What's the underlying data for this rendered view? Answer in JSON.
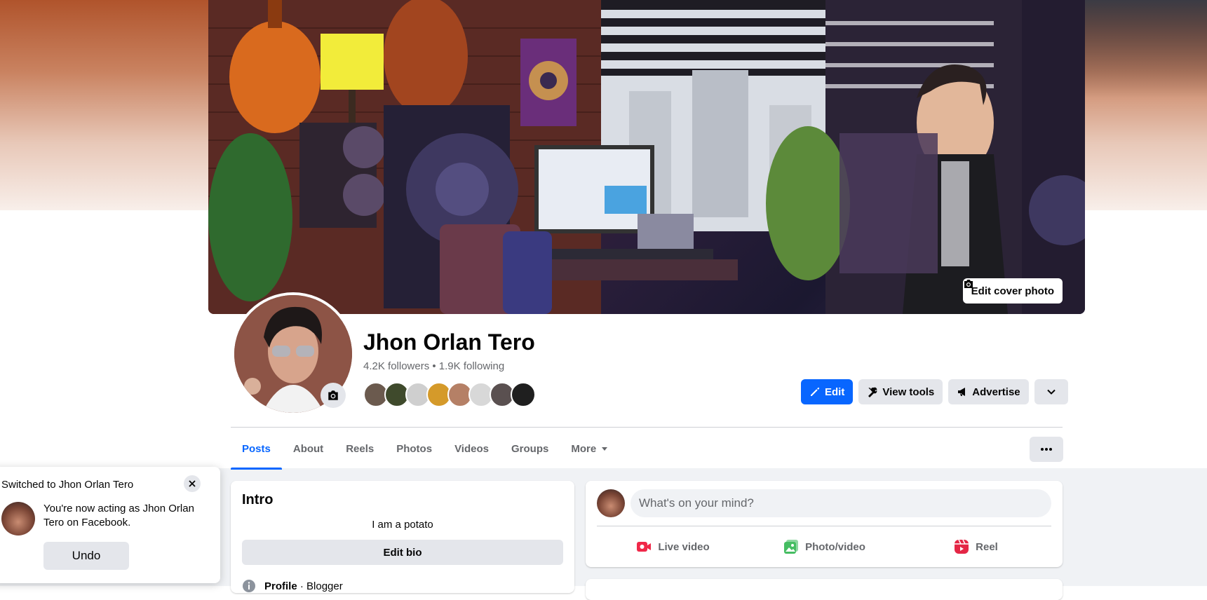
{
  "cover": {
    "edit_label": "Edit cover photo"
  },
  "profile": {
    "name": "Jhon Orlan Tero",
    "stats": "4.2K followers • 1.9K following",
    "friend_face_colors": [
      "#6b5a4e",
      "#3f4a2c",
      "#cfcfcf",
      "#d59a2a",
      "#b58066",
      "#d8d8d8",
      "#5a5050",
      "#1f1f1f"
    ]
  },
  "actions": {
    "edit": "Edit",
    "view_tools": "View tools",
    "advertise": "Advertise"
  },
  "tabs": [
    {
      "label": "Posts",
      "active": true
    },
    {
      "label": "About"
    },
    {
      "label": "Reels"
    },
    {
      "label": "Photos"
    },
    {
      "label": "Videos"
    },
    {
      "label": "Groups"
    },
    {
      "label": "More"
    }
  ],
  "intro": {
    "title": "Intro",
    "bio": "I am a potato",
    "edit_bio": "Edit bio",
    "profile_row_label": "Profile",
    "profile_row_value": "Blogger"
  },
  "composer": {
    "placeholder": "What's on your mind?",
    "live_video": "Live video",
    "photo_video": "Photo/video",
    "reel": "Reel"
  },
  "toast": {
    "title": "Switched to Jhon Orlan Tero",
    "message": "You're now acting as Jhon Orlan Tero on Facebook.",
    "undo": "Undo"
  },
  "colors": {
    "accent": "#0866ff",
    "live": "#f02849",
    "photo": "#45bd62",
    "reel": "#e42645"
  }
}
